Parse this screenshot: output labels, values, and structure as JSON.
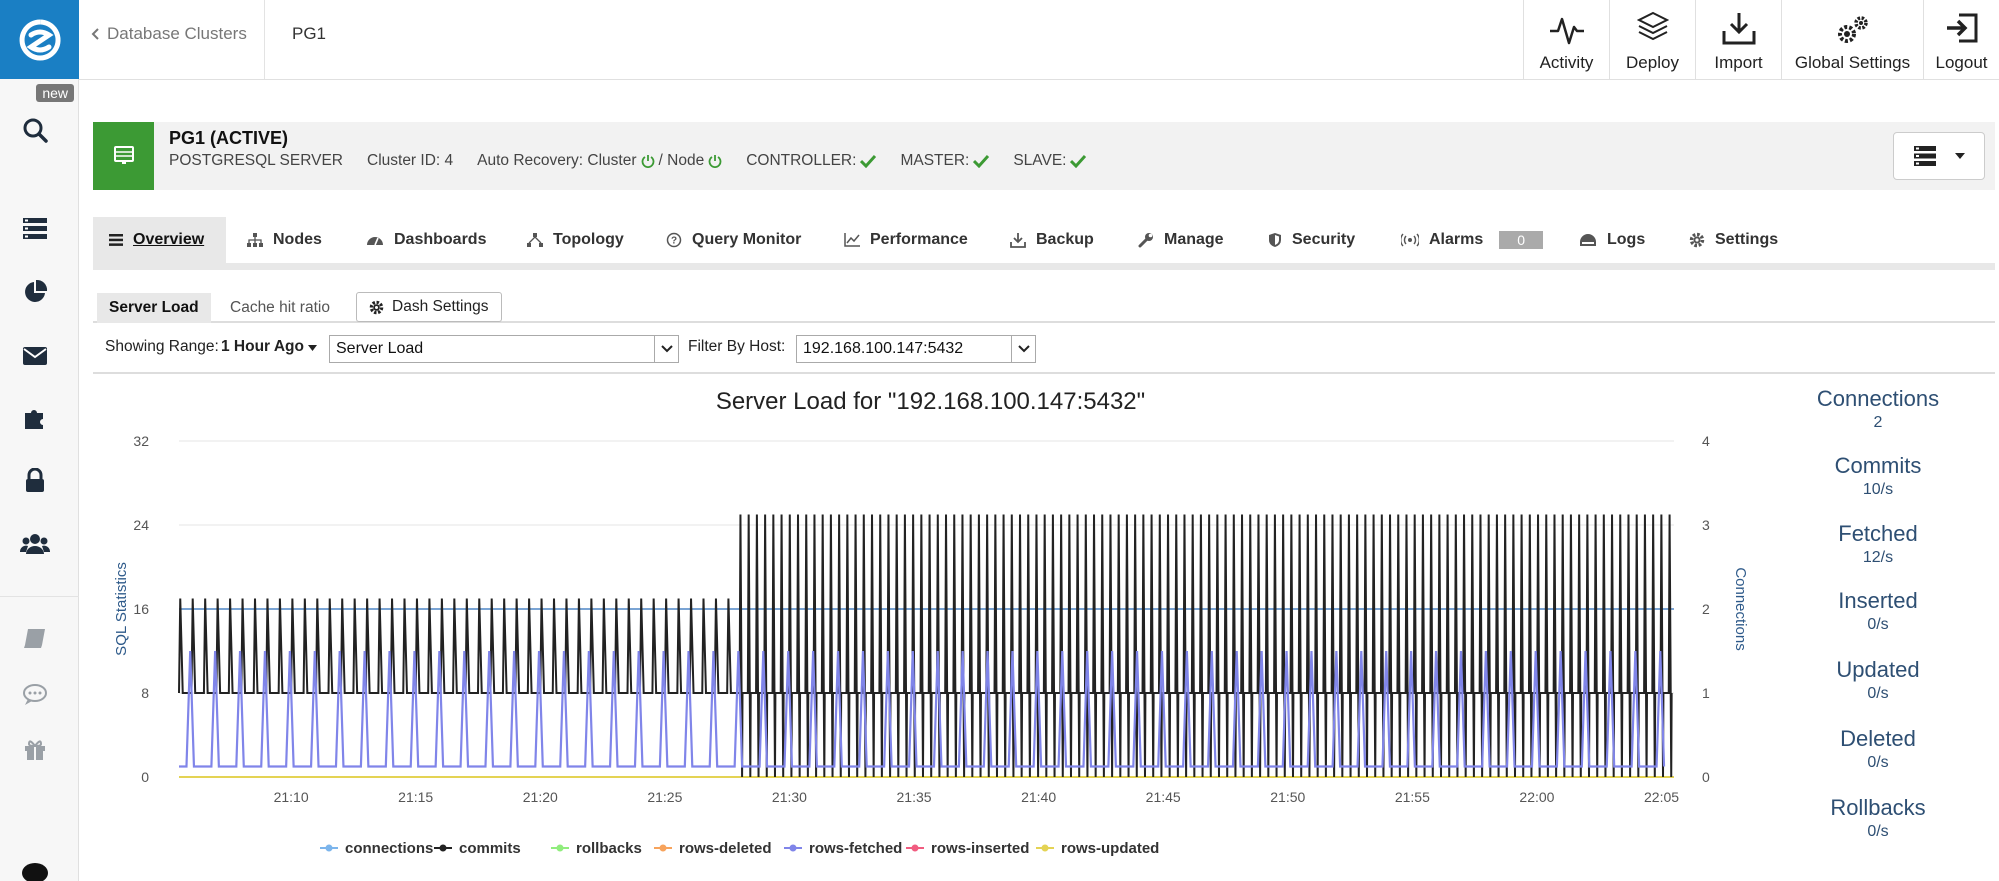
{
  "breadcrumb": {
    "back_label": "Database Clusters",
    "current": "PG1"
  },
  "rail": {
    "new_badge": "new"
  },
  "top_actions": [
    {
      "label": "Activity",
      "icon": "activity-icon"
    },
    {
      "label": "Deploy",
      "icon": "deploy-icon"
    },
    {
      "label": "Import",
      "icon": "import-icon"
    },
    {
      "label": "Global Settings",
      "icon": "gears-icon"
    },
    {
      "label": "Logout",
      "icon": "logout-icon"
    }
  ],
  "cluster": {
    "name": "PG1 (ACTIVE)",
    "type": "POSTGRESQL SERVER",
    "cluster_id": "Cluster ID: 4",
    "auto_recovery": "Auto Recovery: Cluster",
    "node_label": "/ Node",
    "controller": "CONTROLLER:",
    "master": "MASTER:",
    "slave": "SLAVE:"
  },
  "tabs": [
    {
      "label": "Overview",
      "icon": "list-icon",
      "active": true
    },
    {
      "label": "Nodes",
      "icon": "sitemap-icon"
    },
    {
      "label": "Dashboards",
      "icon": "dashboard-icon"
    },
    {
      "label": "Topology",
      "icon": "topology-icon"
    },
    {
      "label": "Query Monitor",
      "icon": "query-icon"
    },
    {
      "label": "Performance",
      "icon": "line-chart-icon"
    },
    {
      "label": "Backup",
      "icon": "download-icon"
    },
    {
      "label": "Manage",
      "icon": "wrench-icon"
    },
    {
      "label": "Security",
      "icon": "shield-icon"
    },
    {
      "label": "Alarms",
      "icon": "broadcast-icon",
      "badge": "0"
    },
    {
      "label": "Logs",
      "icon": "logs-icon"
    },
    {
      "label": "Settings",
      "icon": "gear-icon"
    }
  ],
  "subtabs": {
    "server_load": "Server Load",
    "cache_hit": "Cache hit ratio",
    "dash_settings": "Dash Settings"
  },
  "filters": {
    "range_label": "Showing Range:",
    "range_value": "1 Hour Ago",
    "dashboard_select": "Server Load",
    "host_label": "Filter By Host:",
    "host_select": "192.168.100.147:5432"
  },
  "colors": {
    "connections": "#7cb5ec",
    "commits": "#222222",
    "rollbacks": "#90ed7d",
    "rows-deleted": "#f7a35c",
    "rows-fetched": "#8085e9",
    "rows-inserted": "#f15c80",
    "rows-updated": "#e4d354",
    "brand": "#1a7fc4",
    "success": "#3c9a34"
  },
  "chart_data": {
    "type": "line",
    "title": "Server Load for \"192.168.100.147:5432\"",
    "ylabel": "SQL Statistics",
    "y2label": "Connections",
    "ylim": [
      0,
      32
    ],
    "y2lim": [
      0,
      4
    ],
    "yticks": [
      "0",
      "8",
      "16",
      "24",
      "32"
    ],
    "y2ticks": [
      "0",
      "1",
      "2",
      "3",
      "4"
    ],
    "xticks": [
      "21:10",
      "21:15",
      "21:20",
      "21:25",
      "21:30",
      "21:35",
      "21:40",
      "21:45",
      "21:50",
      "21:55",
      "22:00",
      "22:05"
    ],
    "x_start_minute": 5.5,
    "x_end_minute": 65.5,
    "series": [
      {
        "name": "connections",
        "axis": "right",
        "baseline": 2,
        "note": "flat"
      },
      {
        "name": "commits",
        "axis": "left",
        "baseline": 8,
        "peak_before": 17,
        "peak_after": 25,
        "change_minute": 28,
        "period_before": 0.5,
        "period_after": 0.33
      },
      {
        "name": "rollbacks",
        "axis": "left",
        "baseline": 0
      },
      {
        "name": "rows-deleted",
        "axis": "left",
        "baseline": 0
      },
      {
        "name": "rows-fetched",
        "axis": "left",
        "baseline": 1,
        "peak": 12,
        "period": 1
      },
      {
        "name": "rows-inserted",
        "axis": "left",
        "baseline": 0
      },
      {
        "name": "rows-updated",
        "axis": "left",
        "baseline": 0
      }
    ],
    "legend": "bottom"
  },
  "stats": [
    {
      "name": "Connections",
      "value": "2"
    },
    {
      "name": "Commits",
      "value": "10/s"
    },
    {
      "name": "Fetched",
      "value": "12/s"
    },
    {
      "name": "Inserted",
      "value": "0/s"
    },
    {
      "name": "Updated",
      "value": "0/s"
    },
    {
      "name": "Deleted",
      "value": "0/s"
    },
    {
      "name": "Rollbacks",
      "value": "0/s"
    }
  ]
}
